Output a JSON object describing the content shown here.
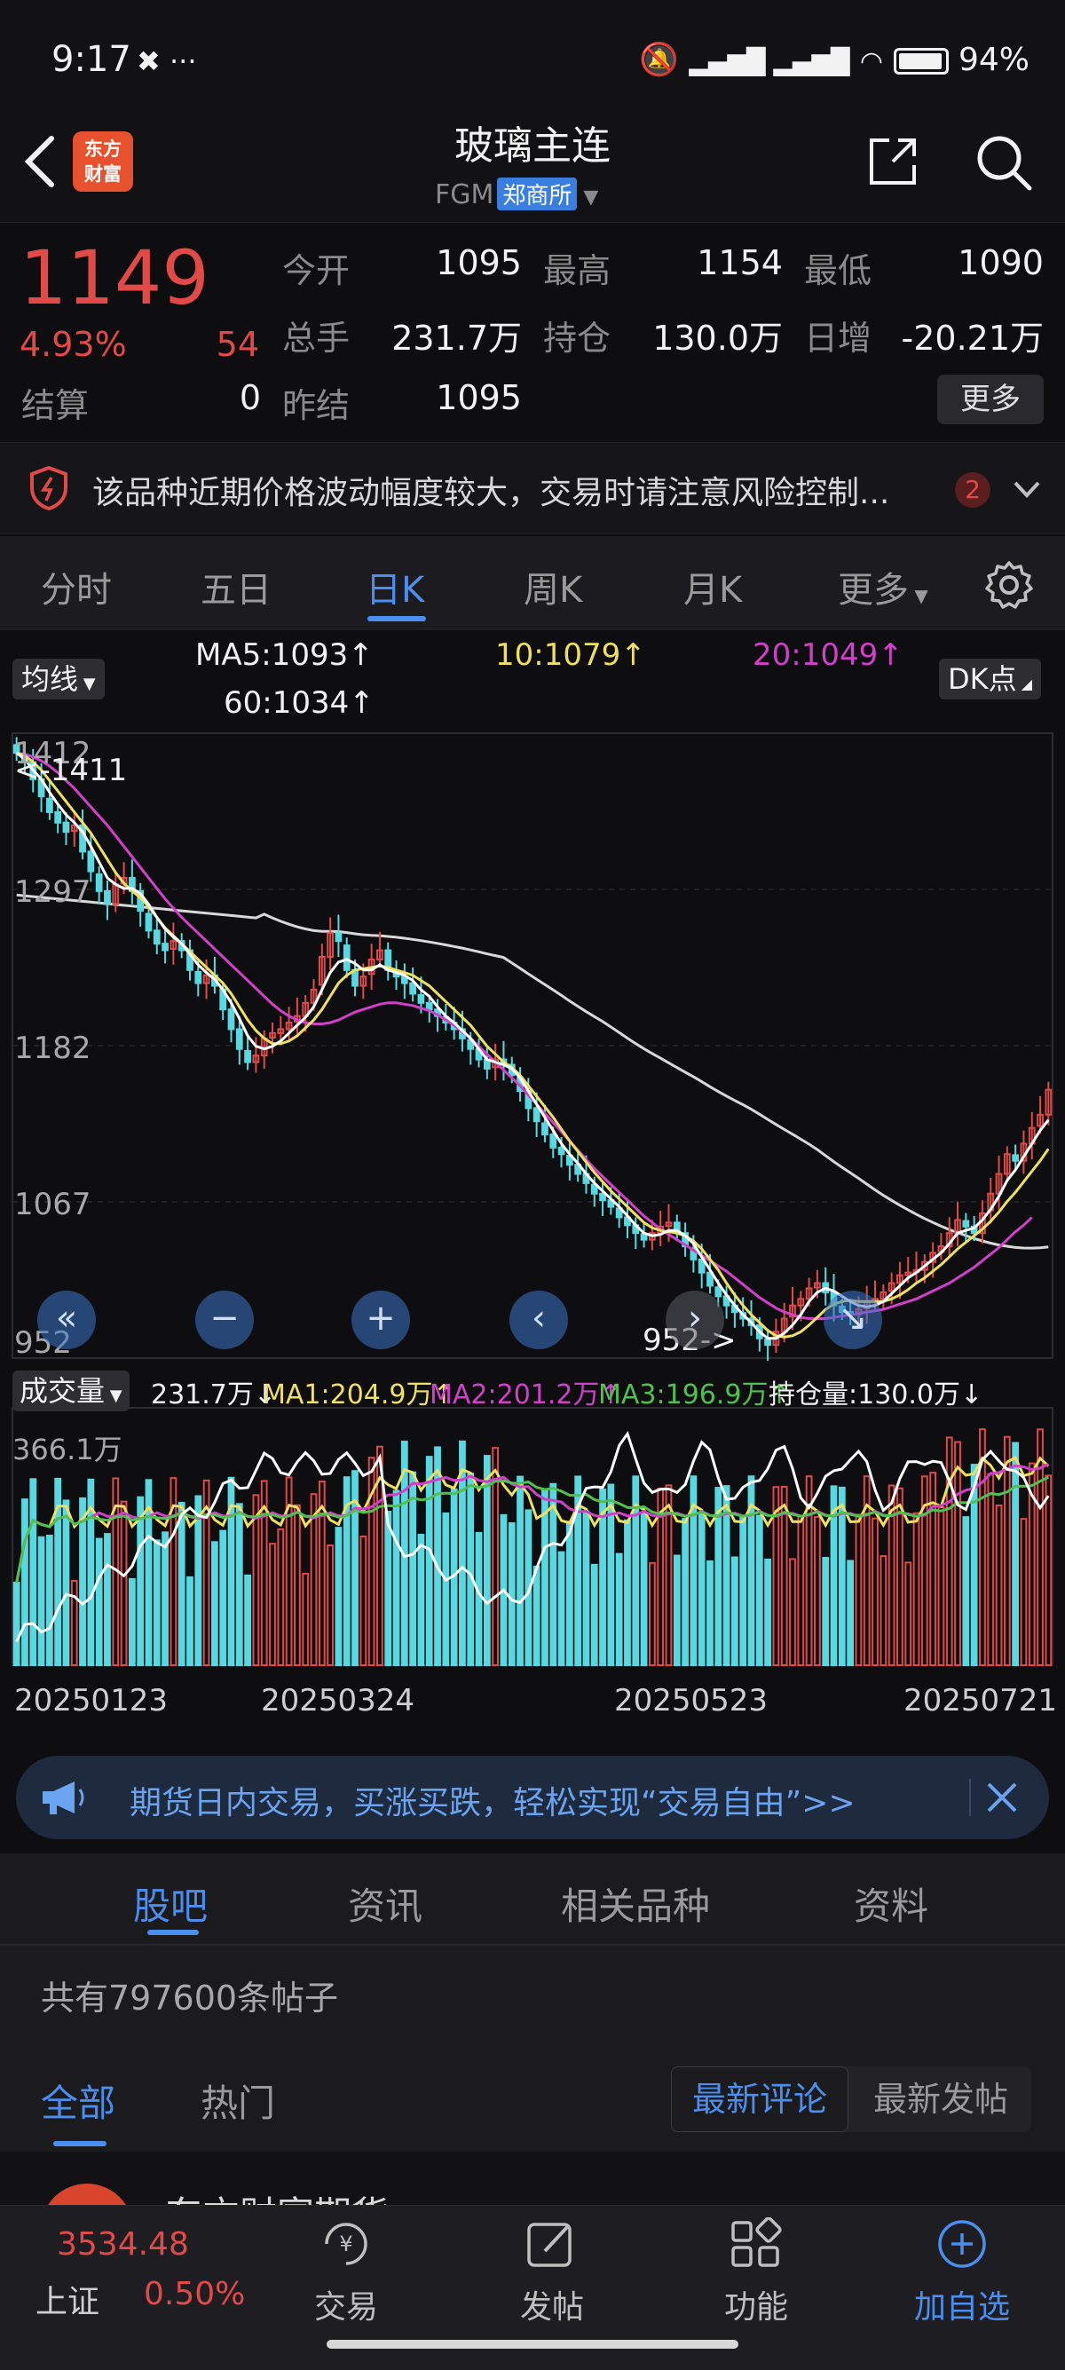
{
  "status_bar": {
    "time": "9:17",
    "battery": "94%"
  },
  "header": {
    "title": "玻璃主连",
    "code": "FGM",
    "exchange": "郑商所",
    "logo_line1": "东方",
    "logo_line2": "财富"
  },
  "quote": {
    "price": "1149",
    "change_pct": "4.93%",
    "change": "54",
    "open_label": "今开",
    "open": "1095",
    "high_label": "最高",
    "high": "1154",
    "low_label": "最低",
    "low": "1090",
    "volume_label": "总手",
    "volume": "231.7万",
    "oi_label": "持仓",
    "oi": "130.0万",
    "daily_inc_label": "日增",
    "daily_inc": "-20.21万",
    "settle_label": "结算",
    "settle": "0",
    "prev_settle_label": "昨结",
    "prev_settle": "1095",
    "more_label": "更多"
  },
  "warning": {
    "text": "该品种近期价格波动幅度较大，交易时请注意风险控制...",
    "badge": "2"
  },
  "period_tabs": [
    "分时",
    "五日",
    "日K",
    "周K",
    "月K",
    "更多"
  ],
  "chart_controls": {
    "ma_select": "均线",
    "dk_label": "DK点",
    "ma5": "MA5:1093↑",
    "ma10": "10:1079↑",
    "ma20": "20:1049↑",
    "ma60": "60:1034↑",
    "high_marker": "<-1411",
    "low_marker": "952->",
    "vol_select": "成交量",
    "vol_value": "231.7万↓",
    "vol_ma1": "MA1:204.9万↑",
    "vol_ma2": "MA2:201.2万↑",
    "vol_ma3": "MA3:196.9万↑",
    "oi_legend": "持仓量:130.0万↓"
  },
  "chart_data": {
    "type": "candlestick",
    "price_axis_labels": [
      "1412",
      "1297",
      "1182",
      "1067",
      "952"
    ],
    "volume_axis_label": "366.1万",
    "x_labels": [
      "20250123",
      "20250324",
      "20250523",
      "20250721"
    ],
    "period_high": 1411,
    "period_low": 952,
    "closes": [
      1405,
      1398,
      1385,
      1372,
      1360,
      1352,
      1345,
      1350,
      1330,
      1315,
      1300,
      1290,
      1305,
      1310,
      1300,
      1285,
      1270,
      1260,
      1255,
      1262,
      1255,
      1240,
      1230,
      1236,
      1228,
      1210,
      1195,
      1180,
      1170,
      1175,
      1188,
      1192,
      1195,
      1200,
      1205,
      1215,
      1225,
      1250,
      1268,
      1262,
      1240,
      1228,
      1235,
      1248,
      1255,
      1240,
      1235,
      1230,
      1222,
      1215,
      1210,
      1205,
      1200,
      1195,
      1188,
      1180,
      1172,
      1165,
      1172,
      1168,
      1160,
      1148,
      1135,
      1125,
      1115,
      1105,
      1100,
      1092,
      1085,
      1078,
      1070,
      1065,
      1060,
      1052,
      1046,
      1040,
      1035,
      1040,
      1045,
      1048,
      1040,
      1030,
      1020,
      1010,
      1000,
      992,
      985,
      980,
      975,
      970,
      960,
      955,
      965,
      975,
      985,
      990,
      998,
      1002,
      995,
      985,
      980,
      978,
      982,
      988,
      990,
      995,
      1002,
      1008,
      1010,
      1012,
      1018,
      1025,
      1030,
      1040,
      1050,
      1045,
      1040,
      1055,
      1070,
      1085,
      1100,
      1095,
      1108,
      1120,
      1130,
      1149
    ],
    "ma5": [
      1405,
      1400,
      1392,
      1385,
      1375,
      1366,
      1358,
      1352,
      1345,
      1334,
      1322,
      1310,
      1305,
      1302,
      1302,
      1298,
      1290,
      1280,
      1271,
      1265,
      1260,
      1252,
      1244,
      1238,
      1233,
      1225,
      1215,
      1203,
      1190,
      1182,
      1180,
      1182,
      1186,
      1192,
      1198,
      1204,
      1212,
      1225,
      1238,
      1246,
      1248,
      1245,
      1240,
      1240,
      1244,
      1240,
      1238,
      1236,
      1232,
      1225,
      1220,
      1212,
      1205,
      1200,
      1194,
      1188,
      1180,
      1172,
      1170,
      1168,
      1165,
      1158,
      1148,
      1138,
      1128,
      1118,
      1108,
      1100,
      1093,
      1085,
      1078,
      1072,
      1066,
      1060,
      1053,
      1046,
      1040,
      1038,
      1039,
      1042,
      1042,
      1038,
      1032,
      1022,
      1012,
      1002,
      993,
      985,
      978,
      972,
      965,
      960,
      960,
      964,
      970,
      978,
      988,
      995,
      998,
      996,
      992,
      988,
      985,
      984,
      985,
      988,
      994,
      1000,
      1006,
      1010,
      1015,
      1020,
      1025,
      1032,
      1040,
      1042,
      1044,
      1050,
      1058,
      1068,
      1080,
      1088,
      1098,
      1108,
      1118,
      1126
    ],
    "ma10": [
      1405,
      1403,
      1398,
      1392,
      1384,
      1376,
      1368,
      1360,
      1352,
      1344,
      1334,
      1324,
      1314,
      1306,
      1300,
      1295,
      1288,
      1280,
      1272,
      1266,
      1260,
      1254,
      1248,
      1242,
      1236,
      1230,
      1222,
      1212,
      1202,
      1194,
      1188,
      1184,
      1184,
      1186,
      1190,
      1196,
      1202,
      1210,
      1220,
      1230,
      1236,
      1240,
      1241,
      1242,
      1243,
      1242,
      1240,
      1238,
      1236,
      1232,
      1228,
      1222,
      1216,
      1210,
      1204,
      1198,
      1190,
      1182,
      1176,
      1170,
      1166,
      1160,
      1152,
      1144,
      1136,
      1128,
      1119,
      1110,
      1102,
      1094,
      1086,
      1079,
      1072,
      1066,
      1060,
      1054,
      1048,
      1044,
      1042,
      1041,
      1040,
      1038,
      1034,
      1028,
      1020,
      1012,
      1002,
      993,
      985,
      978,
      972,
      966,
      962,
      961,
      962,
      965,
      970,
      976,
      982,
      986,
      988,
      989,
      988,
      988,
      988,
      988,
      990,
      993,
      997,
      1002,
      1006,
      1011,
      1016,
      1022,
      1028,
      1033,
      1038,
      1043,
      1049,
      1056,
      1064,
      1071,
      1079,
      1087,
      1095,
      1104
    ],
    "ma20": [
      1405,
      1404,
      1402,
      1399,
      1395,
      1390,
      1384,
      1378,
      1371,
      1364,
      1357,
      1350,
      1342,
      1334,
      1326,
      1318,
      1310,
      1302,
      1294,
      1287,
      1280,
      1274,
      1268,
      1262,
      1256,
      1250,
      1244,
      1238,
      1232,
      1226,
      1220,
      1214,
      1209,
      1205,
      1202,
      1200,
      1199,
      1199,
      1200,
      1202,
      1205,
      1208,
      1210,
      1212,
      1214,
      1215,
      1215,
      1214,
      1213,
      1211,
      1209,
      1206,
      1202,
      1198,
      1193,
      1188,
      1182,
      1176,
      1170,
      1164,
      1158,
      1152,
      1145,
      1138,
      1131,
      1124,
      1117,
      1110,
      1103,
      1096,
      1089,
      1083,
      1077,
      1071,
      1065,
      1059,
      1053,
      1048,
      1043,
      1039,
      1035,
      1031,
      1027,
      1023,
      1019,
      1015,
      1011,
      1006,
      1001,
      996,
      991,
      987,
      983,
      980,
      978,
      976,
      975,
      975,
      975,
      976,
      977,
      978,
      979,
      980,
      981,
      982,
      984,
      986,
      988,
      990,
      993,
      996,
      999,
      1002,
      1006,
      1010,
      1014,
      1019,
      1024,
      1029,
      1035,
      1041,
      1046,
      1052
    ]
  },
  "promo": {
    "text": "期货日内交易，买涨买跌，轻松实现“交易自由”>>"
  },
  "content_tabs": [
    "股吧",
    "资讯",
    "相关品种",
    "资料"
  ],
  "post_count": "共有797600条帖子",
  "filter_tabs": [
    "全部",
    "热门"
  ],
  "sort_options": [
    "最新评论",
    "最新发帖"
  ],
  "peek": {
    "name": "东方财富期货"
  },
  "bottom_nav": {
    "index_value": "3534.48",
    "index_name": "上证",
    "index_pct": "0.50%",
    "items": [
      "交易",
      "发帖",
      "功能",
      "加自选"
    ]
  }
}
